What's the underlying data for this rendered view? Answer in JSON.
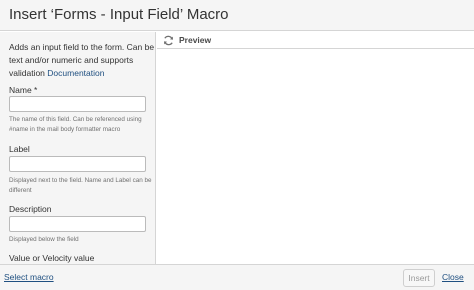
{
  "dialog": {
    "title": "Insert ‘Forms - Input Field’ Macro"
  },
  "left_panel": {
    "intro_text": "Adds an input field to the form. Can be text and/or numeric and supports validation",
    "doc_link": "Documentation",
    "fields": [
      {
        "label": "Name *",
        "value": "",
        "help": "The name of this field. Can be referenced using #name in the mail body formatter macro"
      },
      {
        "label": "Label",
        "value": "",
        "help": "Displayed next to the field. Name and Label can be different"
      },
      {
        "label": "Description",
        "value": "",
        "help": "Displayed below the field"
      },
      {
        "label": "Value or Velocity value"
      }
    ]
  },
  "preview": {
    "label": "Preview",
    "icon": "refresh-icon"
  },
  "footer": {
    "select_macro": "Select macro",
    "insert": "Insert",
    "close": "Close"
  },
  "colors": {
    "link": "#205081",
    "panel_bg": "#f5f5f5",
    "border": "#d5d5d5"
  }
}
